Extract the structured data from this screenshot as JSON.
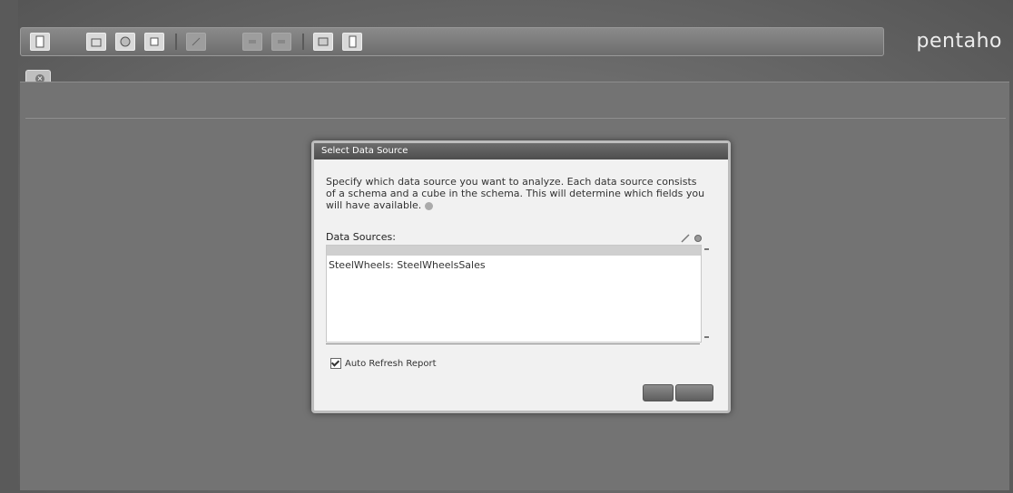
{
  "menubar": {
    "items": [
      "",
      "",
      "",
      ""
    ]
  },
  "toolbar": {
    "icons": [
      "new-report-icon",
      "open-icon",
      "save-icon",
      "chart-icon",
      "filter-icon",
      "refresh-icon",
      "layout-icon",
      "print-icon"
    ]
  },
  "logo": {
    "text": "pentaho"
  },
  "tabs": [
    {
      "label": ""
    }
  ],
  "dialog": {
    "title": "Select Data Source",
    "description": "Specify which data source you want to analyze. Each data source consists of a schema and a cube in the schema. This will determine which fields you will have available.",
    "data_sources_label": "Data Sources:",
    "items": [
      "SteelWheels: SteelWheelsSales"
    ],
    "auto_refresh_label": "Auto Refresh Report",
    "auto_refresh_checked": true,
    "ok_label": "",
    "cancel_label": ""
  }
}
